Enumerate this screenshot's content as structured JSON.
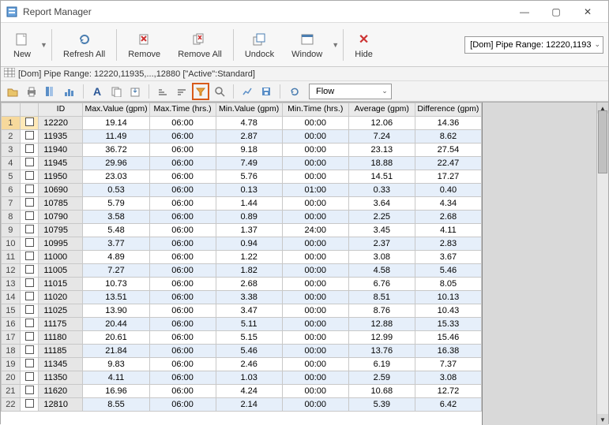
{
  "window": {
    "title": "Report Manager",
    "min_icon": "—",
    "max_icon": "▢",
    "close_icon": "✕"
  },
  "toolbar": {
    "new": "New",
    "refresh": "Refresh All",
    "remove": "Remove",
    "remove_all": "Remove All",
    "undock": "Undock",
    "window": "Window",
    "hide": "Hide",
    "selector_label": "[Dom] Pipe Range: 12220,1193"
  },
  "info_bar": {
    "text": "[Dom] Pipe Range: 12220,11935,...,12880 [\"Active\":Standard]"
  },
  "flow_select": {
    "value": "Flow"
  },
  "grid": {
    "headers": {
      "id": "ID",
      "maxval": "Max.Value\n(gpm)",
      "maxtime": "Max.Time\n(hrs.)",
      "minval": "Min.Value\n(gpm)",
      "mintime": "Min.Time\n(hrs.)",
      "avg": "Average\n(gpm)",
      "diff": "Difference\n(gpm)"
    },
    "rows": [
      {
        "id": "12220",
        "maxval": "19.14",
        "maxtime": "06:00",
        "minval": "4.78",
        "mintime": "00:00",
        "avg": "12.06",
        "diff": "14.36"
      },
      {
        "id": "11935",
        "maxval": "11.49",
        "maxtime": "06:00",
        "minval": "2.87",
        "mintime": "00:00",
        "avg": "7.24",
        "diff": "8.62"
      },
      {
        "id": "11940",
        "maxval": "36.72",
        "maxtime": "06:00",
        "minval": "9.18",
        "mintime": "00:00",
        "avg": "23.13",
        "diff": "27.54"
      },
      {
        "id": "11945",
        "maxval": "29.96",
        "maxtime": "06:00",
        "minval": "7.49",
        "mintime": "00:00",
        "avg": "18.88",
        "diff": "22.47"
      },
      {
        "id": "11950",
        "maxval": "23.03",
        "maxtime": "06:00",
        "minval": "5.76",
        "mintime": "00:00",
        "avg": "14.51",
        "diff": "17.27"
      },
      {
        "id": "10690",
        "maxval": "0.53",
        "maxtime": "06:00",
        "minval": "0.13",
        "mintime": "01:00",
        "avg": "0.33",
        "diff": "0.40"
      },
      {
        "id": "10785",
        "maxval": "5.79",
        "maxtime": "06:00",
        "minval": "1.44",
        "mintime": "00:00",
        "avg": "3.64",
        "diff": "4.34"
      },
      {
        "id": "10790",
        "maxval": "3.58",
        "maxtime": "06:00",
        "minval": "0.89",
        "mintime": "00:00",
        "avg": "2.25",
        "diff": "2.68"
      },
      {
        "id": "10795",
        "maxval": "5.48",
        "maxtime": "06:00",
        "minval": "1.37",
        "mintime": "24:00",
        "avg": "3.45",
        "diff": "4.11"
      },
      {
        "id": "10995",
        "maxval": "3.77",
        "maxtime": "06:00",
        "minval": "0.94",
        "mintime": "00:00",
        "avg": "2.37",
        "diff": "2.83"
      },
      {
        "id": "11000",
        "maxval": "4.89",
        "maxtime": "06:00",
        "minval": "1.22",
        "mintime": "00:00",
        "avg": "3.08",
        "diff": "3.67"
      },
      {
        "id": "11005",
        "maxval": "7.27",
        "maxtime": "06:00",
        "minval": "1.82",
        "mintime": "00:00",
        "avg": "4.58",
        "diff": "5.46"
      },
      {
        "id": "11015",
        "maxval": "10.73",
        "maxtime": "06:00",
        "minval": "2.68",
        "mintime": "00:00",
        "avg": "6.76",
        "diff": "8.05"
      },
      {
        "id": "11020",
        "maxval": "13.51",
        "maxtime": "06:00",
        "minval": "3.38",
        "mintime": "00:00",
        "avg": "8.51",
        "diff": "10.13"
      },
      {
        "id": "11025",
        "maxval": "13.90",
        "maxtime": "06:00",
        "minval": "3.47",
        "mintime": "00:00",
        "avg": "8.76",
        "diff": "10.43"
      },
      {
        "id": "11175",
        "maxval": "20.44",
        "maxtime": "06:00",
        "minval": "5.11",
        "mintime": "00:00",
        "avg": "12.88",
        "diff": "15.33"
      },
      {
        "id": "11180",
        "maxval": "20.61",
        "maxtime": "06:00",
        "minval": "5.15",
        "mintime": "00:00",
        "avg": "12.99",
        "diff": "15.46"
      },
      {
        "id": "11185",
        "maxval": "21.84",
        "maxtime": "06:00",
        "minval": "5.46",
        "mintime": "00:00",
        "avg": "13.76",
        "diff": "16.38"
      },
      {
        "id": "11345",
        "maxval": "9.83",
        "maxtime": "06:00",
        "minval": "2.46",
        "mintime": "00:00",
        "avg": "6.19",
        "diff": "7.37"
      },
      {
        "id": "11350",
        "maxval": "4.11",
        "maxtime": "06:00",
        "minval": "1.03",
        "mintime": "00:00",
        "avg": "2.59",
        "diff": "3.08"
      },
      {
        "id": "11620",
        "maxval": "16.96",
        "maxtime": "06:00",
        "minval": "4.24",
        "mintime": "00:00",
        "avg": "10.68",
        "diff": "12.72"
      },
      {
        "id": "12810",
        "maxval": "8.55",
        "maxtime": "06:00",
        "minval": "2.14",
        "mintime": "00:00",
        "avg": "5.39",
        "diff": "6.42"
      }
    ]
  }
}
